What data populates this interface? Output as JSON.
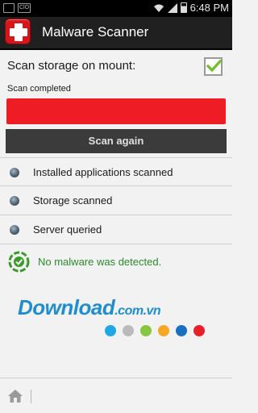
{
  "status_bar": {
    "time": "6:48 PM",
    "left_icon_text": "ClO"
  },
  "app": {
    "title": "Malware Scanner"
  },
  "settings": {
    "scan_on_mount_label": "Scan storage on mount:",
    "scan_on_mount_checked": true
  },
  "scan": {
    "status_text": "Scan completed",
    "progress_color": "#ee1c24",
    "button_label": "Scan again"
  },
  "status_items": [
    {
      "label": "Installed applications scanned"
    },
    {
      "label": "Storage scanned"
    },
    {
      "label": "Server queried"
    }
  ],
  "result": {
    "label": "No malware was detected.",
    "color": "#2a8a2a"
  },
  "watermark": {
    "text_main": "Download",
    "text_suffix": ".com.vn",
    "dot_colors": [
      "#1ea7e6",
      "#bbbbbb",
      "#88c541",
      "#f7a823",
      "#1a6fc0",
      "#e8202a"
    ]
  },
  "bottom_bar": {
    "icon": "home-icon"
  }
}
